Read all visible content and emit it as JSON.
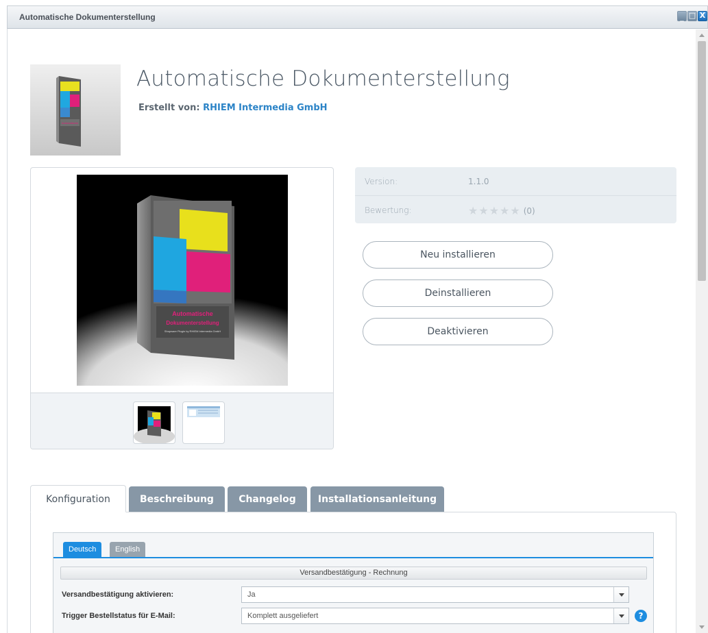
{
  "window": {
    "title": "Automatische Dokumenterstellung",
    "minimize_glyph": "_",
    "maximize_glyph": "□",
    "close_glyph": "X"
  },
  "plugin": {
    "title": "Automatische Dokumenterstellung",
    "author_label": "Erstellt von:",
    "author_name": "RHIEM Intermedia GmbH",
    "box_brand_text": "Automatische Dokumenterstellung",
    "box_subtitle": "Shopware Plugin by RHIEM Intermedia GmbH"
  },
  "info": {
    "version_label": "Version:",
    "version_value": "1.1.0",
    "rating_label": "Bewertung:",
    "rating_stars": "★★★★★",
    "rating_stars_filled": 0,
    "rating_count": "(0)"
  },
  "actions": {
    "reinstall": "Neu installieren",
    "uninstall": "Deinstallieren",
    "deactivate": "Deaktivieren"
  },
  "tabs": [
    {
      "label": "Konfiguration",
      "active": true
    },
    {
      "label": "Beschreibung",
      "active": false
    },
    {
      "label": "Changelog",
      "active": false
    },
    {
      "label": "Installationsanleitung",
      "active": false
    }
  ],
  "config": {
    "languages": [
      {
        "label": "Deutsch",
        "active": true
      },
      {
        "label": "English",
        "active": false
      }
    ],
    "section_title": "Versandbestätigung - Rechnung",
    "fields": [
      {
        "label": "Versandbestätigung aktivieren:",
        "value": "Ja",
        "help": false
      },
      {
        "label": "Trigger Bestellstatus für E-Mail:",
        "value": "Komplett ausgeliefert",
        "help": true
      }
    ],
    "help_glyph": "?"
  },
  "colors": {
    "accent": "#1d8de0",
    "link": "#2c84c7",
    "tab_inactive": "#8797a6",
    "info_panel": "#e9eef2"
  }
}
